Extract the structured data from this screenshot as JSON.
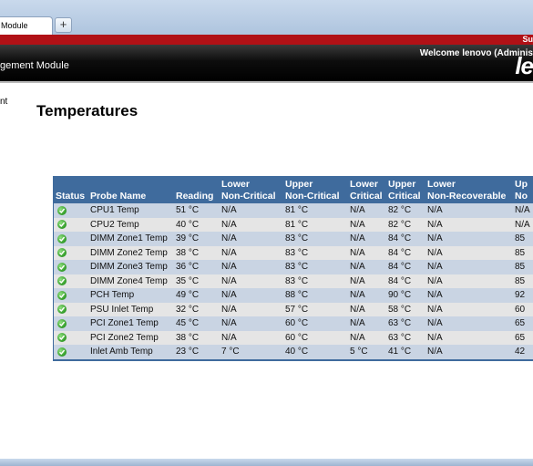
{
  "browser": {
    "tab_label": "Module",
    "new_tab_glyph": "+"
  },
  "topbar": {
    "right_text": "Su"
  },
  "header": {
    "title": "gement Module",
    "welcome": "Welcome lenovo (Adminis",
    "logo_text": "le"
  },
  "sidebar_fragment": "nt",
  "page_title": "Temperatures",
  "table": {
    "headers": [
      [
        "Status"
      ],
      [
        "Probe Name"
      ],
      [
        "Reading"
      ],
      [
        "Lower",
        "Non-Critical"
      ],
      [
        "Upper",
        "Non-Critical"
      ],
      [
        "Lower",
        "Critical"
      ],
      [
        "Upper",
        "Critical"
      ],
      [
        "Lower",
        "Non-Recoverable"
      ],
      [
        "Up",
        "No"
      ]
    ],
    "rows": [
      {
        "status": "ok",
        "name": "CPU1 Temp",
        "reading": "51 °C",
        "lnc": "N/A",
        "unc": "81 °C",
        "lc": "N/A",
        "uc": "82 °C",
        "lnr": "N/A",
        "unr": "N/A"
      },
      {
        "status": "ok",
        "name": "CPU2 Temp",
        "reading": "40 °C",
        "lnc": "N/A",
        "unc": "81 °C",
        "lc": "N/A",
        "uc": "82 °C",
        "lnr": "N/A",
        "unr": "N/A"
      },
      {
        "status": "ok",
        "name": "DIMM Zone1 Temp",
        "reading": "39 °C",
        "lnc": "N/A",
        "unc": "83 °C",
        "lc": "N/A",
        "uc": "84 °C",
        "lnr": "N/A",
        "unr": "85"
      },
      {
        "status": "ok",
        "name": "DIMM Zone2 Temp",
        "reading": "38 °C",
        "lnc": "N/A",
        "unc": "83 °C",
        "lc": "N/A",
        "uc": "84 °C",
        "lnr": "N/A",
        "unr": "85"
      },
      {
        "status": "ok",
        "name": "DIMM Zone3 Temp",
        "reading": "36 °C",
        "lnc": "N/A",
        "unc": "83 °C",
        "lc": "N/A",
        "uc": "84 °C",
        "lnr": "N/A",
        "unr": "85"
      },
      {
        "status": "ok",
        "name": "DIMM Zone4 Temp",
        "reading": "35 °C",
        "lnc": "N/A",
        "unc": "83 °C",
        "lc": "N/A",
        "uc": "84 °C",
        "lnr": "N/A",
        "unr": "85"
      },
      {
        "status": "ok",
        "name": "PCH Temp",
        "reading": "49 °C",
        "lnc": "N/A",
        "unc": "88 °C",
        "lc": "N/A",
        "uc": "90 °C",
        "lnr": "N/A",
        "unr": "92"
      },
      {
        "status": "ok",
        "name": "PSU Inlet Temp",
        "reading": "32 °C",
        "lnc": "N/A",
        "unc": "57 °C",
        "lc": "N/A",
        "uc": "58 °C",
        "lnr": "N/A",
        "unr": "60"
      },
      {
        "status": "ok",
        "name": "PCI Zone1 Temp",
        "reading": "45 °C",
        "lnc": "N/A",
        "unc": "60 °C",
        "lc": "N/A",
        "uc": "63 °C",
        "lnr": "N/A",
        "unr": "65"
      },
      {
        "status": "ok",
        "name": "PCI Zone2 Temp",
        "reading": "38 °C",
        "lnc": "N/A",
        "unc": "60 °C",
        "lc": "N/A",
        "uc": "63 °C",
        "lnr": "N/A",
        "unr": "65"
      },
      {
        "status": "ok",
        "name": "Inlet Amb Temp",
        "reading": "23 °C",
        "lnc": "7 °C",
        "unc": "40 °C",
        "lc": "5 °C",
        "uc": "41 °C",
        "lnr": "N/A",
        "unr": "42"
      }
    ]
  },
  "colors": {
    "header_bg": "#000000",
    "accent_red": "#b11116",
    "table_header": "#3f6b9d",
    "row_blue": "#c9d4e3",
    "row_gray": "#e5e5e5",
    "status_ok": "#2f9a25"
  },
  "icons": {
    "status_ok": "green-check-circle-icon"
  }
}
